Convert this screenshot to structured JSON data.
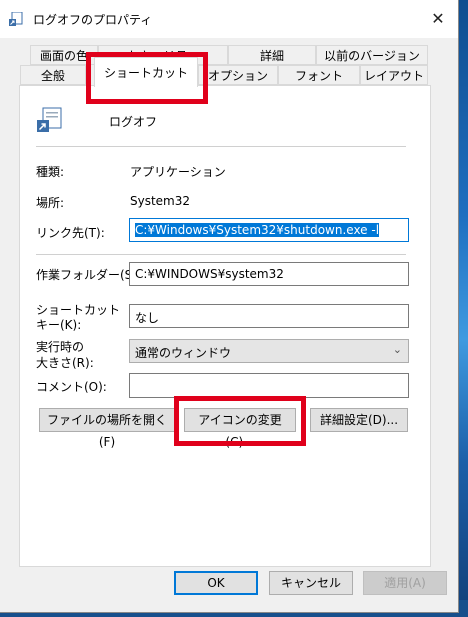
{
  "window": {
    "title": "ログオフのプロパティ"
  },
  "tabs_row1": [
    "画面の色",
    "セキュリティ",
    "詳細",
    "以前のバージョン"
  ],
  "tabs_row2": [
    "全般",
    "ショートカット",
    "オプション",
    "フォント",
    "レイアウト"
  ],
  "active_tab": "ショートカット",
  "shortcut_name": "ログオフ",
  "props": {
    "type_label": "種類:",
    "type_value": "アプリケーション",
    "location_label": "場所:",
    "location_value": "System32",
    "target_label": "リンク先(T):",
    "target_value": "C:¥Windows¥System32¥shutdown.exe -l",
    "startin_label": "作業フォルダー(S):",
    "startin_value": "C:¥WINDOWS¥system32",
    "hotkey_label_1": "ショートカット",
    "hotkey_label_2": "キー(K):",
    "hotkey_value": "なし",
    "run_label_1": "実行時の",
    "run_label_2": "大きさ(R):",
    "run_value": "通常のウィンドウ",
    "comment_label": "コメント(O):",
    "comment_value": ""
  },
  "buttons": {
    "open_location": "ファイルの場所を開く(F)",
    "change_icon": "アイコンの変更(C)...",
    "advanced": "詳細設定(D)...",
    "ok": "OK",
    "cancel": "キャンセル",
    "apply": "適用(A)"
  },
  "colors": {
    "highlight": "#e0001b",
    "accent": "#0078d7"
  }
}
